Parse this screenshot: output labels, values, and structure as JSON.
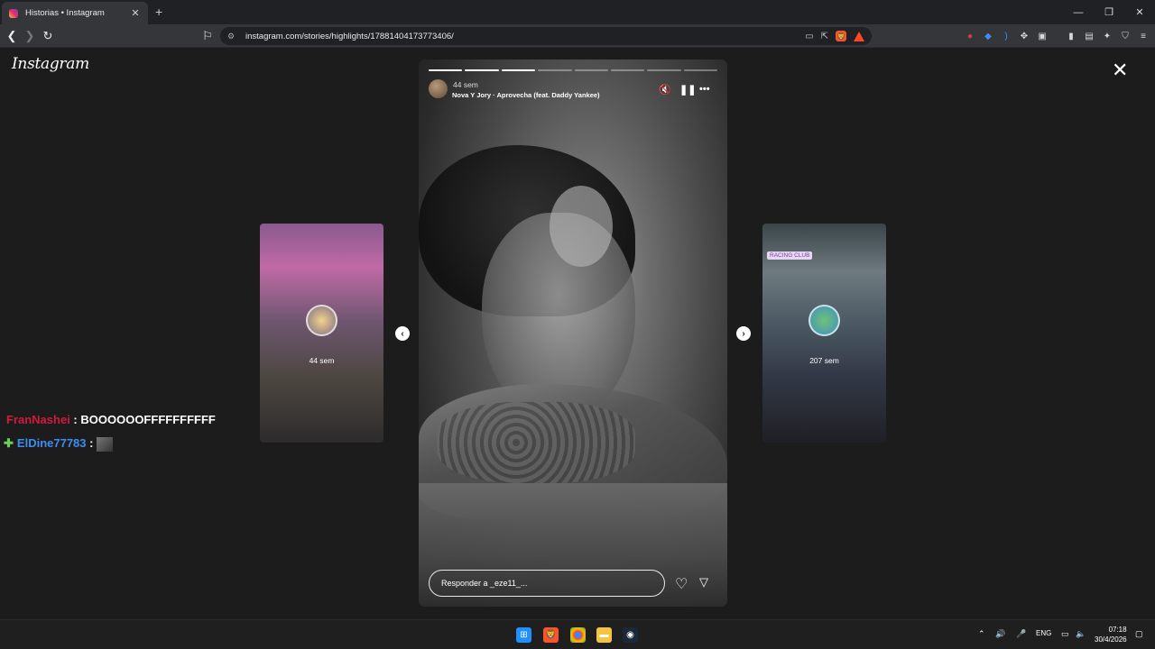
{
  "browser": {
    "tab_title": "Historias • Instagram",
    "tab_close": "✕",
    "new_tab": "+",
    "url": "instagram.com/stories/highlights/17881404173773406/"
  },
  "page": {
    "logo": "Instagram",
    "close": "✕"
  },
  "story": {
    "progress_segments_total": 8,
    "progress_segments_done": 3,
    "time": "44 sem",
    "song": "Nova Y Jory · Aprovecha (feat. Daddy Yankee)",
    "reply_placeholder": "Responder a _eze11_..."
  },
  "prev_story": {
    "label": "44 sem"
  },
  "next_story": {
    "label": "207 sem",
    "tag": "RACING CLUB"
  },
  "chat": [
    {
      "user": "FranNashei",
      "message": "BOOOOOOFFFFFFFFFF"
    },
    {
      "user": "ElDine77783",
      "message": ""
    }
  ],
  "taskbar": {
    "lang": "ENG",
    "time": "07:18",
    "date": "30/4/2026"
  }
}
